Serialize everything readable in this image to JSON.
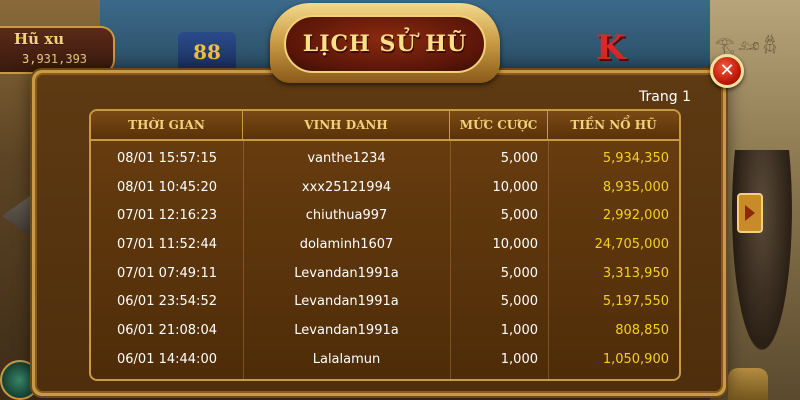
{
  "background": {
    "jackpot_title": "Hũ xu",
    "jackpot_value": "3,931,393",
    "reel_symbol_1": "88",
    "reel_symbol_2": "K",
    "glyphs": "𓂀𓃭𓆣"
  },
  "modal": {
    "title": "LỊCH SỬ HŨ",
    "page_label": "Trang 1",
    "close_label": "✕",
    "columns": [
      "THỜI GIAN",
      "VINH DANH",
      "MỨC CƯỢC",
      "TIỀN NỔ HŨ"
    ],
    "rows": [
      {
        "time": "08/01 15:57:15",
        "user": "vanthe1234",
        "bet": "5,000",
        "prize": "5,934,350"
      },
      {
        "time": "08/01 10:45:20",
        "user": "xxx25121994",
        "bet": "10,000",
        "prize": "8,935,000"
      },
      {
        "time": "07/01 12:16:23",
        "user": "chiuthua997",
        "bet": "5,000",
        "prize": "2,992,000"
      },
      {
        "time": "07/01 11:52:44",
        "user": "dolaminh1607",
        "bet": "10,000",
        "prize": "24,705,000"
      },
      {
        "time": "07/01 07:49:11",
        "user": "Levandan1991a",
        "bet": "5,000",
        "prize": "3,313,950"
      },
      {
        "time": "06/01 23:54:52",
        "user": "Levandan1991a",
        "bet": "5,000",
        "prize": "5,197,550"
      },
      {
        "time": "06/01 21:08:04",
        "user": "Levandan1991a",
        "bet": "1,000",
        "prize": "808,850"
      },
      {
        "time": "06/01 14:44:00",
        "user": "Lalalamun",
        "bet": "1,000",
        "prize": "1,050,900"
      }
    ]
  },
  "colors": {
    "prize_text": "#f3d020",
    "header_text": "#f3d07a",
    "gold_border": "#c99a44",
    "panel_bg": "#5e3a12"
  }
}
